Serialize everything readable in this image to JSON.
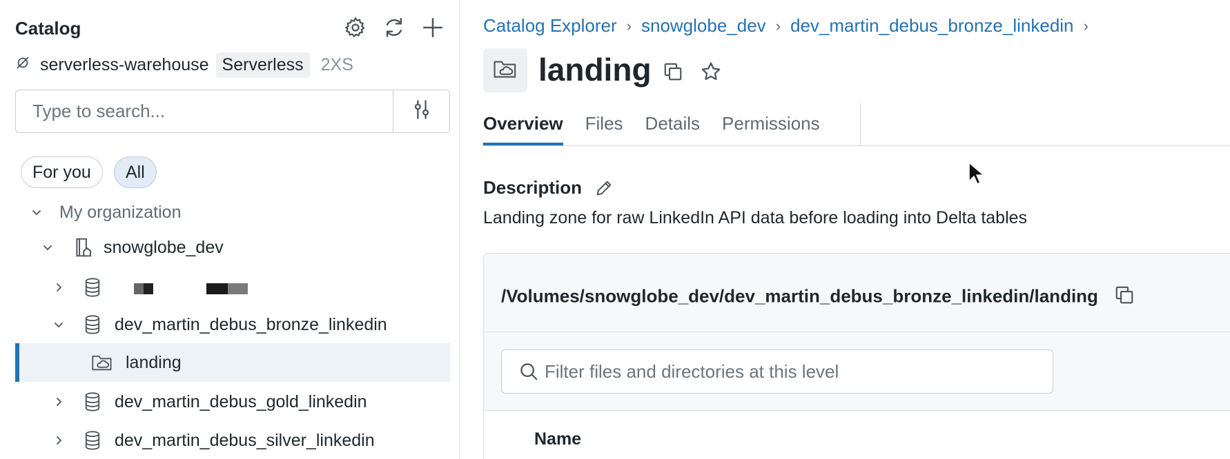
{
  "sidebar": {
    "title": "Catalog",
    "header_icons": [
      "gear-icon",
      "refresh-icon",
      "plus-icon"
    ],
    "warehouse": {
      "icon": "warehouse-status-icon",
      "name": "serverless-warehouse",
      "badge": "Serverless",
      "size": "2XS"
    },
    "search": {
      "placeholder": "Type to search..."
    },
    "filter_chips": [
      {
        "label": "For you",
        "active": false
      },
      {
        "label": "All",
        "active": true
      }
    ],
    "tree": {
      "org_label": "My organization",
      "catalog": "snowglobe_dev",
      "schemas": [
        {
          "label": "",
          "redacted": true,
          "expanded": false
        },
        {
          "label": "dev_martin_debus_bronze_linkedin",
          "expanded": true
        },
        {
          "label": "landing",
          "type": "volume",
          "selected": true
        },
        {
          "label": "dev_martin_debus_gold_linkedin",
          "expanded": false
        },
        {
          "label": "dev_martin_debus_silver_linkedin",
          "expanded": false
        }
      ]
    }
  },
  "main": {
    "breadcrumbs": [
      "Catalog Explorer",
      "snowglobe_dev",
      "dev_martin_debus_bronze_linkedin"
    ],
    "title": "landing",
    "tabs": [
      {
        "label": "Overview",
        "active": true
      },
      {
        "label": "Files",
        "active": false
      },
      {
        "label": "Details",
        "active": false
      },
      {
        "label": "Permissions",
        "active": false
      }
    ],
    "description": {
      "label": "Description",
      "text": "Landing zone for raw LinkedIn API data before loading into Delta tables"
    },
    "files": {
      "path": "/Volumes/snowglobe_dev/dev_martin_debus_bronze_linkedin/landing",
      "filter_placeholder": "Filter files and directories at this level",
      "columns": [
        "Name"
      ]
    }
  },
  "colors": {
    "accent": "#2272b4",
    "link": "#2272b4",
    "selected_bg": "#edf2f7",
    "chip_active_bg": "#e3ebf6"
  }
}
